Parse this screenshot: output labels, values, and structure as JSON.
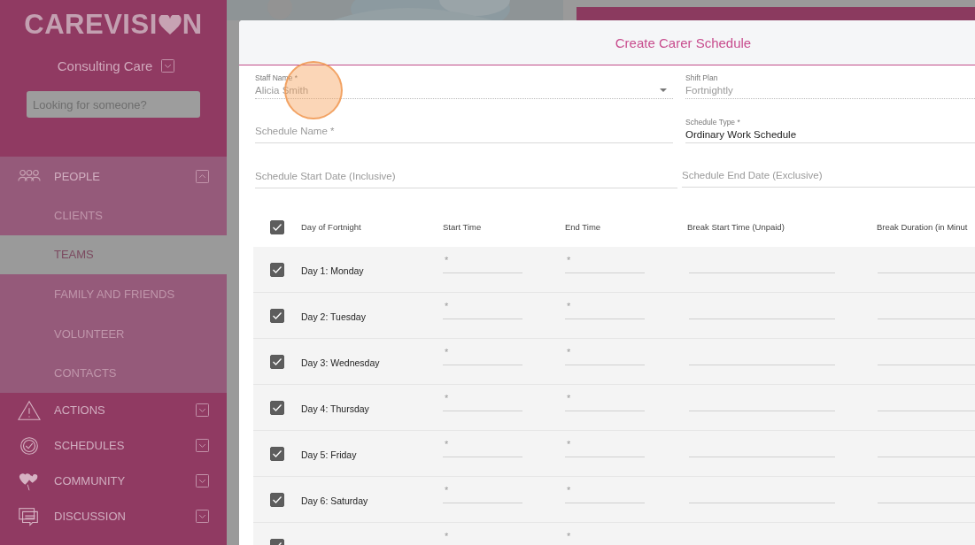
{
  "sidebar": {
    "logo": {
      "before": "CAREVISI",
      "after": "N"
    },
    "organization": "Consulting Care",
    "search": {
      "placeholder": "Looking for someone?"
    },
    "nav": [
      {
        "label": "PEOPLE",
        "kind": "people",
        "expanded": true,
        "children": [
          {
            "label": "CLIENTS",
            "selected": false
          },
          {
            "label": "TEAMS",
            "selected": true
          },
          {
            "label": "FAMILY AND FRIENDS",
            "selected": false
          },
          {
            "label": "VOLUNTEER",
            "selected": false
          },
          {
            "label": "CONTACTS",
            "selected": false
          }
        ]
      },
      {
        "label": "ACTIONS",
        "kind": "alert",
        "expanded": false
      },
      {
        "label": "SCHEDULES",
        "kind": "clock",
        "expanded": false
      },
      {
        "label": "COMMUNITY",
        "kind": "hearts",
        "expanded": false
      },
      {
        "label": "DISCUSSION",
        "kind": "chat",
        "expanded": false
      }
    ]
  },
  "modal": {
    "title": "Create Carer Schedule",
    "field_rows": [
      [
        {
          "label": "Staff Name *",
          "value": "Alicia Smith",
          "kind": "select"
        },
        {
          "label": "Shift Plan",
          "value": "Fortnightly",
          "kind": "readonly"
        }
      ],
      [
        {
          "placeholder": "Schedule Name *",
          "kind": "text"
        },
        {
          "label": "Schedule Type *",
          "value": "Ordinary Work Schedule",
          "kind": "text"
        }
      ],
      [
        {
          "placeholder": "Schedule Start Date (Inclusive)",
          "kind": "text"
        },
        {
          "placeholder": "Schedule End Date (Exclusive)",
          "kind": "text"
        }
      ]
    ],
    "table": {
      "all_checked": true,
      "columns": [
        "Day of Fortnight",
        "Start Time",
        "End Time",
        "Break Start Time (Unpaid)",
        "Break Duration (in Minut"
      ],
      "rows": [
        {
          "day": "Day 1: Monday",
          "checked": true,
          "start_placeholder": "*",
          "end_placeholder": "*"
        },
        {
          "day": "Day 2: Tuesday",
          "checked": true,
          "start_placeholder": "*",
          "end_placeholder": "*"
        },
        {
          "day": "Day 3: Wednesday",
          "checked": true,
          "start_placeholder": "*",
          "end_placeholder": "*"
        },
        {
          "day": "Day 4: Thursday",
          "checked": true,
          "start_placeholder": "*",
          "end_placeholder": "*"
        },
        {
          "day": "Day 5: Friday",
          "checked": true,
          "start_placeholder": "*",
          "end_placeholder": "*"
        },
        {
          "day": "Day 6: Saturday",
          "checked": true,
          "start_placeholder": "*",
          "end_placeholder": "*"
        },
        {
          "checked": true,
          "start_placeholder": "*",
          "end_placeholder": "*"
        }
      ]
    }
  }
}
